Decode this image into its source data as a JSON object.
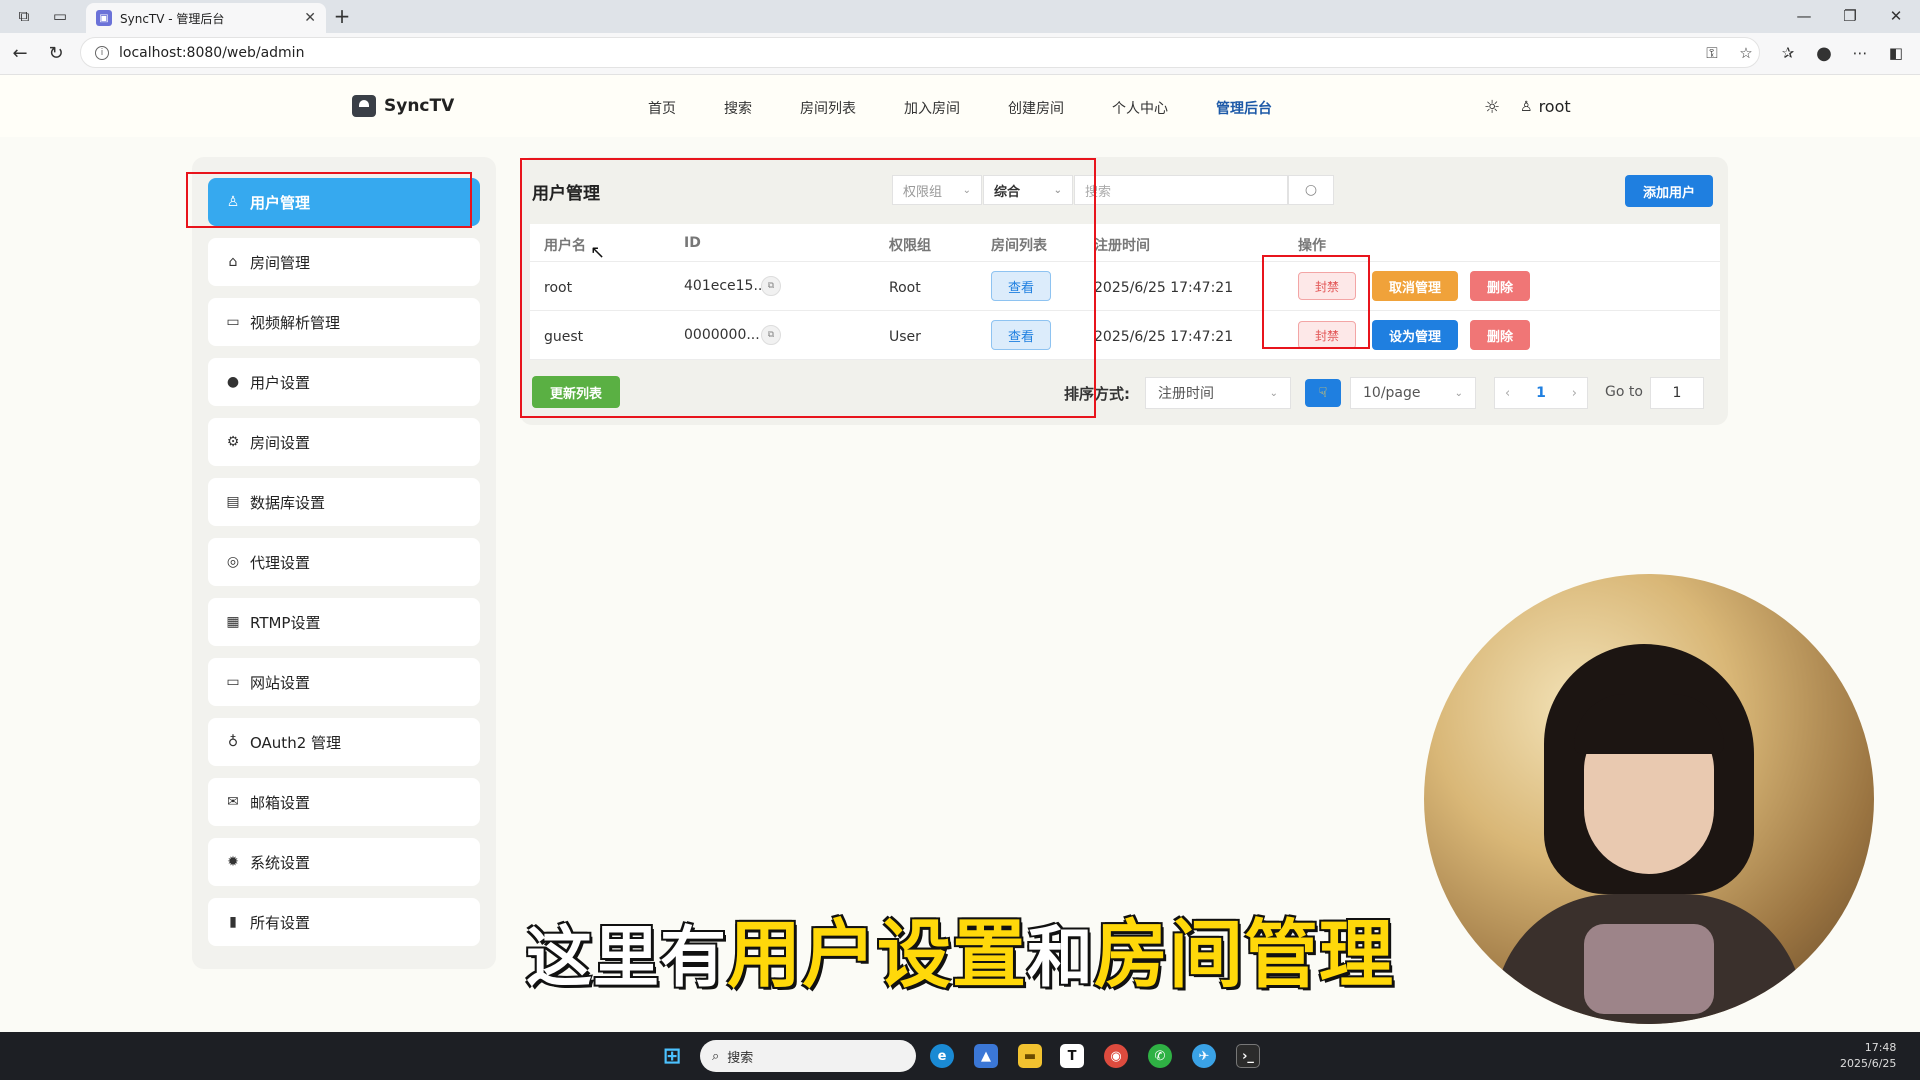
{
  "browser": {
    "tab_title": "SyncTV - 管理后台",
    "url": "localhost:8080/web/admin"
  },
  "nav": {
    "brand": "SyncTV",
    "links": [
      "首页",
      "搜索",
      "房间列表",
      "加入房间",
      "创建房间",
      "个人中心",
      "管理后台"
    ],
    "active": "管理后台",
    "username": "root"
  },
  "sidebar": {
    "items": [
      {
        "label": "用户管理",
        "icon": "user-icon",
        "active": true
      },
      {
        "label": "房间管理",
        "icon": "home-icon"
      },
      {
        "label": "视频解析管理",
        "icon": "video-icon"
      },
      {
        "label": "用户设置",
        "icon": "person-icon"
      },
      {
        "label": "房间设置",
        "icon": "gear-icon"
      },
      {
        "label": "数据库设置",
        "icon": "database-icon"
      },
      {
        "label": "代理设置",
        "icon": "proxy-icon"
      },
      {
        "label": "RTMP设置",
        "icon": "grid-icon"
      },
      {
        "label": "网站设置",
        "icon": "monitor-icon"
      },
      {
        "label": "OAuth2 管理",
        "icon": "key-icon"
      },
      {
        "label": "邮箱设置",
        "icon": "mail-icon"
      },
      {
        "label": "系统设置",
        "icon": "cog-icon"
      },
      {
        "label": "所有设置",
        "icon": "clipboard-icon"
      }
    ]
  },
  "panel": {
    "title": "用户管理",
    "filter_role_placeholder": "权限组",
    "filter_sort_value": "综合",
    "search_placeholder": "搜索",
    "add_user_label": "添加用户",
    "columns": [
      "用户名",
      "ID",
      "权限组",
      "房间列表",
      "注册时间",
      "操作"
    ],
    "rows": [
      {
        "username": "root",
        "id": "401ece15...",
        "role": "Root",
        "view": "查看",
        "registered": "2025/6/25 17:47:21",
        "ban": "封禁",
        "manage": "取消管理",
        "manage_color": "#f0a23a",
        "delete": "删除"
      },
      {
        "username": "guest",
        "id": "0000000...",
        "role": "User",
        "view": "查看",
        "registered": "2025/6/25 17:47:21",
        "ban": "封禁",
        "manage": "设为管理",
        "manage_color": "#1f7fe0",
        "delete": "删除"
      }
    ],
    "refresh_label": "更新列表",
    "sort_label": "排序方式:",
    "sort_value": "注册时间",
    "page_size": "10/page",
    "current_page": "1",
    "goto_label": "Go to",
    "goto_value": "1"
  },
  "subtitle": {
    "part1": "这里有",
    "part2": "用户设置",
    "part3": "和",
    "part4": "房间管理"
  },
  "taskbar": {
    "search_placeholder": "搜索",
    "time": "17:48",
    "date": "2025/6/25"
  },
  "colors": {
    "accent": "#1f7fe0",
    "sidebar_active": "#36a9ef",
    "refresh": "#5ab043",
    "danger": "#f07676",
    "annotation": "#e8141c"
  }
}
